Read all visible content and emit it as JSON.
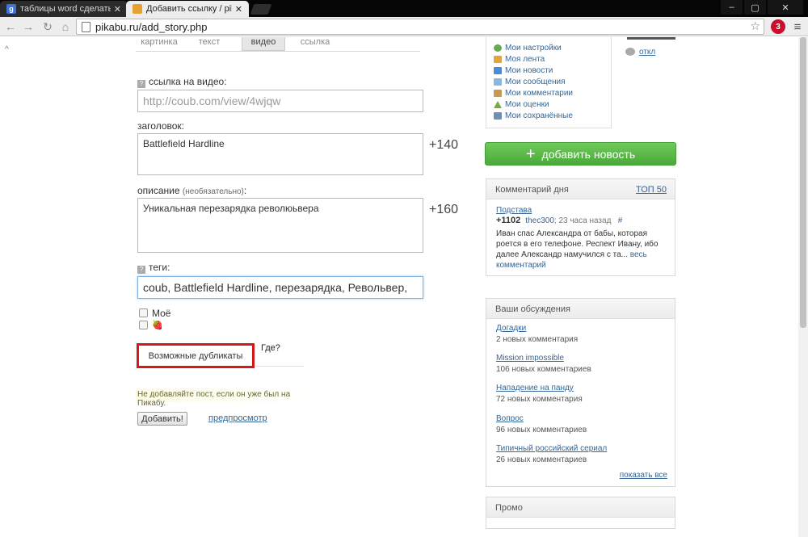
{
  "browser": {
    "tabs": [
      {
        "title": "таблицы word сделать о",
        "favicon": "g"
      },
      {
        "title": "Добавить ссылку / pikab",
        "favicon": "pikabu"
      }
    ],
    "url": "pikabu.ru/add_story.php",
    "extension_badge": "3"
  },
  "post_type_tabs": [
    "картинка",
    "текст",
    "видео",
    "ссылка"
  ],
  "active_post_type": "видео",
  "form": {
    "video_label": "ссылка на видео:",
    "video_placeholder": "http://coub.com/view/4wjqw",
    "title_label": "заголовок:",
    "title_value": "Battlefield Hardline",
    "title_counter": "+140",
    "desc_label": "описание",
    "desc_optional": "(необязательно)",
    "desc_label_suffix": ":",
    "desc_value": "Уникальная перезарядка революьвера",
    "desc_counter": "+160",
    "tags_label": "теги:",
    "tags_value": "coub, Battlefield Hardline, перезарядка, Револьвер,",
    "mine_label": "Моё",
    "duplicates_button": "Возможные дубликаты",
    "where_link": "Где?",
    "notice": "Не добавляйте пост, если он уже был на Пикабу.",
    "submit_button": "Добавить!",
    "preview_link": "предпросмотр"
  },
  "user_menu": {
    "items": [
      "Мои настройки",
      "Моя лента",
      "Мои новости",
      "Мои сообщения",
      "Мои комментарии",
      "Мои оценки",
      "Мои сохранённые"
    ],
    "logout": "откл"
  },
  "add_news_button": "добавить новость",
  "comment_of_day": {
    "heading": "Комментарий дня",
    "top_link": "ТОП 50",
    "post_link": "Подстава",
    "rating": "+1102",
    "user": "thec300",
    "time": "; 23 часа назад",
    "hash": "#",
    "text": "Иван спас Александра от бабы, которая роется в его телефоне. Респект Ивану, ибо далее Александр намучился с та...",
    "full_link": "весь комментарий"
  },
  "discussions": {
    "heading": "Ваши обсуждения",
    "items": [
      {
        "title": "Догадки",
        "count": "2 новых комментария"
      },
      {
        "title": "Mission impossible",
        "count": "106 новых комментариев"
      },
      {
        "title": "Нападение на панду",
        "count": "72 новых комментария"
      },
      {
        "title": "Вопрос",
        "count": "96 новых комментариев"
      },
      {
        "title": "Типичный российский сериал",
        "count": "26 новых комментариев"
      }
    ],
    "show_all": "показать все"
  },
  "promo": {
    "heading": "Промо"
  }
}
